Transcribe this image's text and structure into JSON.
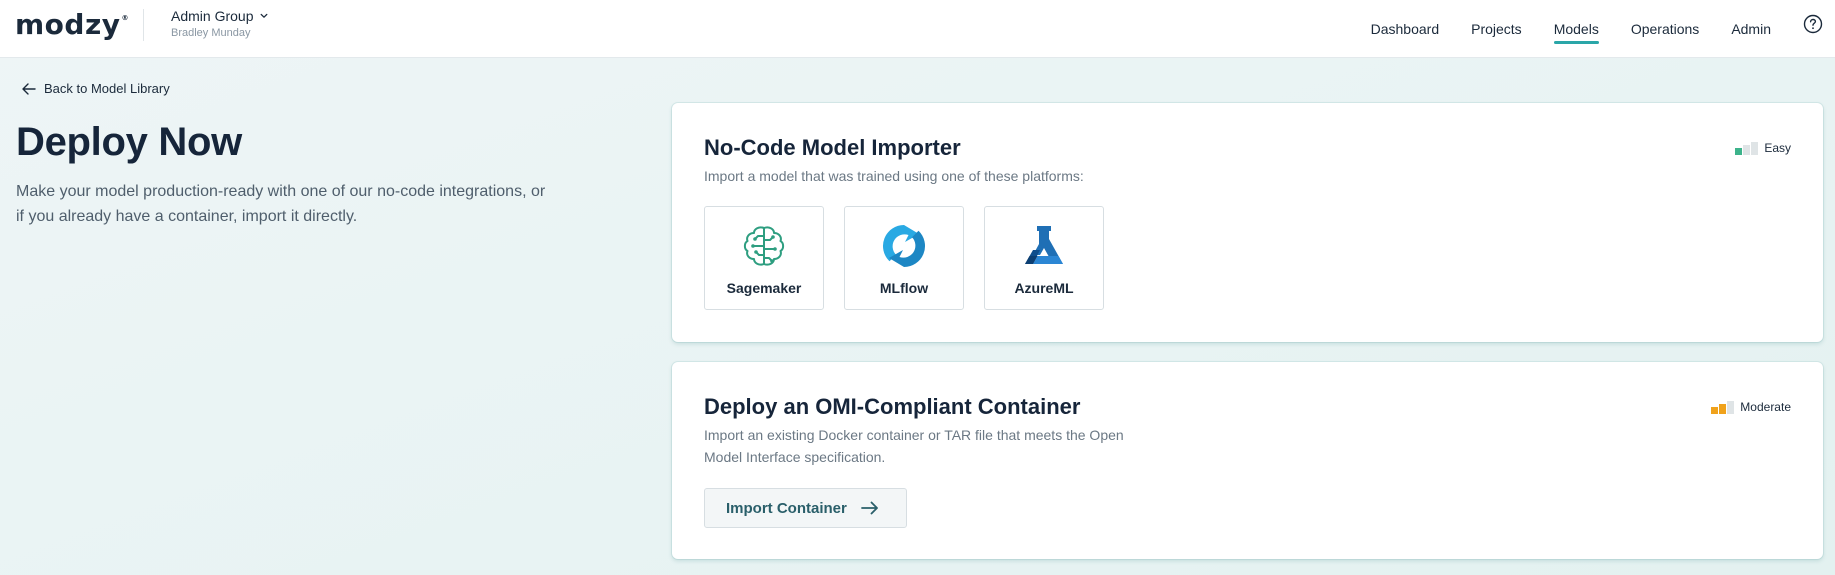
{
  "header": {
    "logo_text": "modzy",
    "logo_mark": "®",
    "group_name": "Admin Group",
    "user_name": "Bradley Munday",
    "nav": [
      {
        "label": "Dashboard"
      },
      {
        "label": "Projects"
      },
      {
        "label": "Models"
      },
      {
        "label": "Operations"
      },
      {
        "label": "Admin"
      }
    ],
    "active_nav": "Models",
    "help_icon": "question-circle-icon"
  },
  "left": {
    "back_label": "Back to Model Library",
    "title": "Deploy Now",
    "description": "Make your model production-ready with one of our no-code integrations, or if you already have a container, import it directly."
  },
  "importer": {
    "title": "No-Code Model Importer",
    "subtitle": "Import a model that was trained using one of these platforms:",
    "difficulty": "Easy",
    "difficulty_level": 1,
    "platforms": [
      {
        "label": "Sagemaker",
        "icon": "sagemaker-brain-icon",
        "color": "#2e9e80"
      },
      {
        "label": "MLflow",
        "icon": "mlflow-refresh-icon",
        "color": "#29a9e3"
      },
      {
        "label": "AzureML",
        "icon": "azureml-flask-icon",
        "color": "#1f6fb5"
      }
    ]
  },
  "container": {
    "title": "Deploy an OMI-Compliant Container",
    "subtitle": "Import an existing Docker container or TAR file that meets the Open Model Interface specification.",
    "difficulty": "Moderate",
    "difficulty_level": 2,
    "button_label": "Import Container"
  },
  "colors": {
    "accent": "#2aa6a8",
    "easy": "#3cb38b",
    "moderate": "#f0a21b"
  }
}
